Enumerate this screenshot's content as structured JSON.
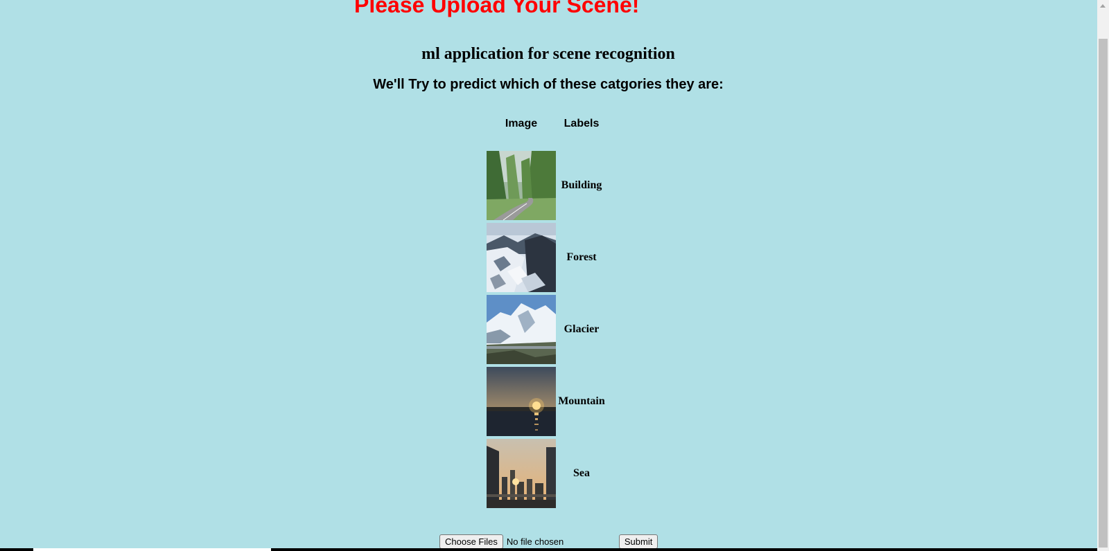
{
  "banner": {
    "text": "Please Upload Your Scene!",
    "color": "#ff0000"
  },
  "header": {
    "title": "ml application for scene recognition",
    "subtitle": "We'll Try to predict which of these catgories they are:"
  },
  "table": {
    "headers": {
      "image": "Image",
      "labels": "Labels"
    },
    "rows": [
      {
        "label": "Building",
        "image": "forest-road-thumbnail"
      },
      {
        "label": "Forest",
        "image": "rocky-mountain-thumbnail"
      },
      {
        "label": "Glacier",
        "image": "snowy-peaks-thumbnail"
      },
      {
        "label": "Mountain",
        "image": "sunset-sea-thumbnail"
      },
      {
        "label": "Sea",
        "image": "city-sunset-thumbnail"
      }
    ]
  },
  "form": {
    "choose_label": "Choose Files",
    "file_status": "No file chosen",
    "submit_label": "Submit"
  },
  "colors": {
    "background": "#b0e0e6",
    "accent": "#ff0000"
  }
}
